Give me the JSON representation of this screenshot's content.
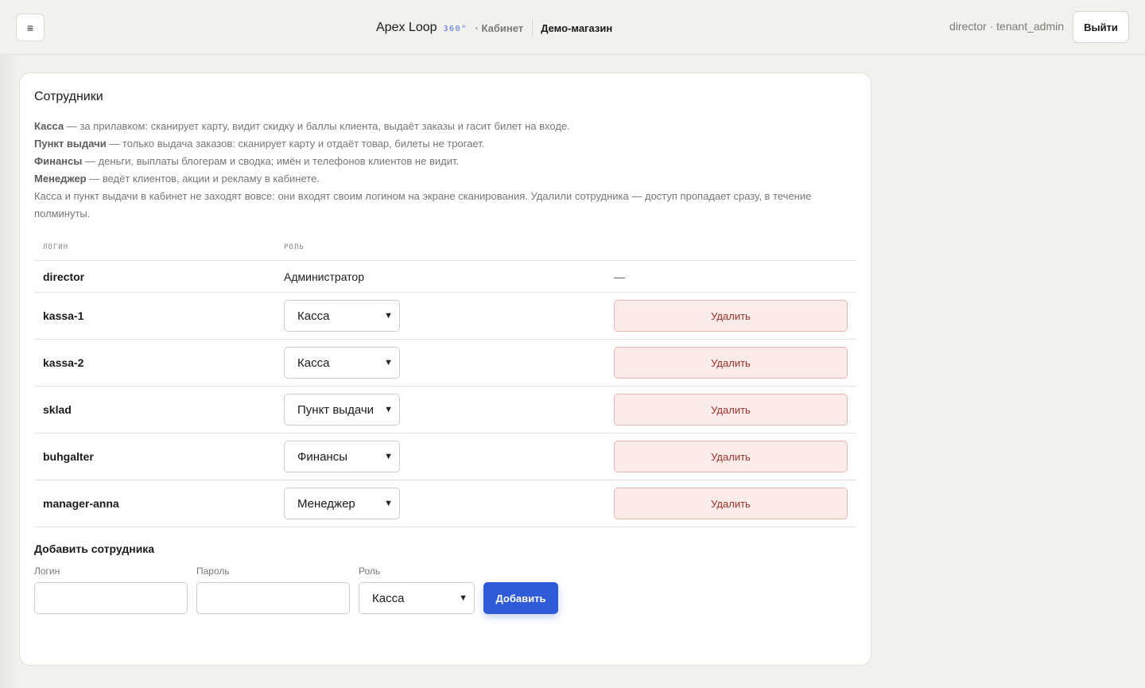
{
  "header": {
    "menu_icon": "≡",
    "brand_name": "Apex Loop",
    "brand_badge": "360°",
    "section": "· Кабинет",
    "shop": "Демо-магазин",
    "user": "director · tenant_admin",
    "logout_label": "Выйти"
  },
  "card": {
    "title": "Сотрудники",
    "desc": [
      {
        "term": "Касса",
        "text": " — за прилавком: сканирует карту, видит скидку и баллы клиента, выдаёт заказы и гасит билет на входе."
      },
      {
        "term": "Пункт выдачи",
        "text": " — только выдача заказов: сканирует карту и отдаёт товар, билеты не трогает."
      },
      {
        "term": "Финансы",
        "text": " — деньги, выплаты блогерам и сводка; имён и телефонов клиентов не видит."
      },
      {
        "term": "Менеджер",
        "text": " — ведёт клиентов, акции и рекламу в кабинете."
      }
    ],
    "note": "Касса и пункт выдачи в кабинет не заходят вовсе: они входят своим логином на экране сканирования. Удалили сотрудника — доступ пропадает сразу, в течение полминуты."
  },
  "table": {
    "col_login": "ЛОГИН",
    "col_role": "РОЛЬ",
    "rows": [
      {
        "login": "director",
        "role": "Администратор",
        "static": true,
        "action": "—"
      },
      {
        "login": "kassa-1",
        "role": "Касса",
        "action": "Удалить"
      },
      {
        "login": "kassa-2",
        "role": "Касса",
        "action": "Удалить"
      },
      {
        "login": "sklad",
        "role": "Пункт выдачи",
        "action": "Удалить"
      },
      {
        "login": "buhgalter",
        "role": "Финансы",
        "action": "Удалить"
      },
      {
        "login": "manager-anna",
        "role": "Менеджер",
        "action": "Удалить"
      }
    ]
  },
  "add_form": {
    "title": "Добавить сотрудника",
    "login_label": "Логин",
    "login_value": "",
    "password_label": "Пароль",
    "password_value": "",
    "role_label": "Роль",
    "role_value": "Касса",
    "submit_label": "Добавить"
  },
  "icons": {
    "select_chevron": "chevron-down-icon",
    "menu": "hamburger-menu-icon"
  },
  "colors": {
    "accent": "#2f5bd8",
    "danger_text": "#9c2f28",
    "danger_bg": "#fbecea",
    "badge": "#4a6ee0"
  }
}
